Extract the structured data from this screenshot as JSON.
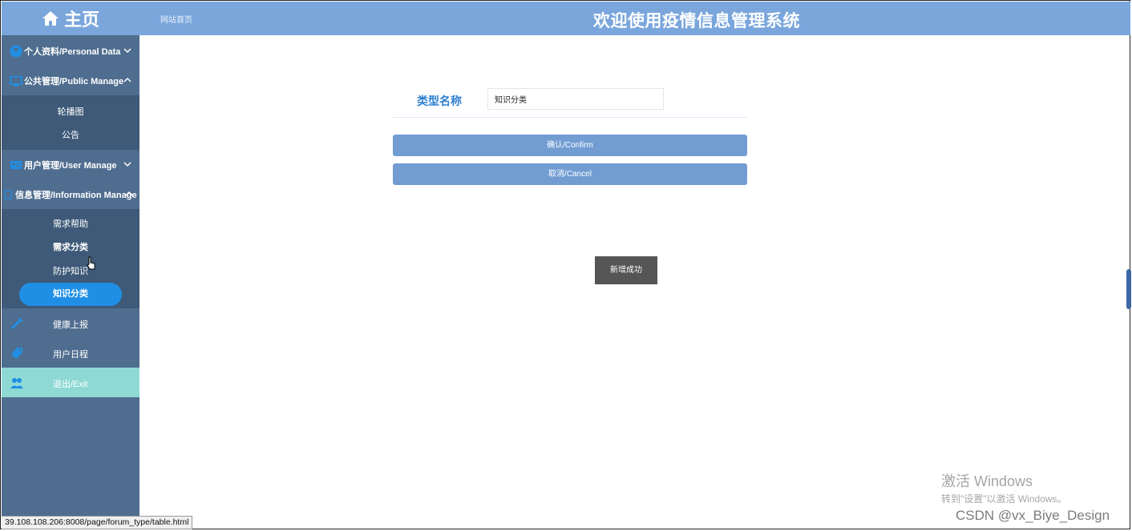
{
  "sidebar": {
    "home_label": "主页",
    "groups": [
      {
        "label": "个人资料/Personal Data"
      },
      {
        "label": "公共管理/Public Manage",
        "items": [
          "轮播图",
          "公告"
        ]
      },
      {
        "label": "用户管理/User Manage"
      },
      {
        "label": "信息管理/Information Manage",
        "items": [
          "需求帮助",
          "需求分类",
          "防护知识",
          "知识分类"
        ]
      }
    ],
    "plain_items": [
      "健康上报",
      "用户日程"
    ],
    "exit_label": "退出/Exit",
    "active_item": "知识分类"
  },
  "topbar": {
    "breadcrumb": "网站首页",
    "title": "欢迎使用疫情信息管理系统"
  },
  "form": {
    "label": "类型名称",
    "value": "知识分类",
    "confirm_label": "确认/Confirm",
    "cancel_label": "取消/Cancel"
  },
  "toast": {
    "message": "新增成功"
  },
  "overlay": {
    "activate_title": "激活 Windows",
    "activate_sub": "转到\"设置\"以激活 Windows。",
    "watermark": "CSDN @vx_Biye_Design"
  },
  "statusbar": {
    "url": "39.108.108.206:8008/page/forum_type/table.html"
  },
  "colors": {
    "accent": "#7aa6dc",
    "sidebar": "#4f6d8f",
    "button": "#729dd3",
    "active": "#1f8fe6",
    "exit": "#8fd9d5"
  }
}
